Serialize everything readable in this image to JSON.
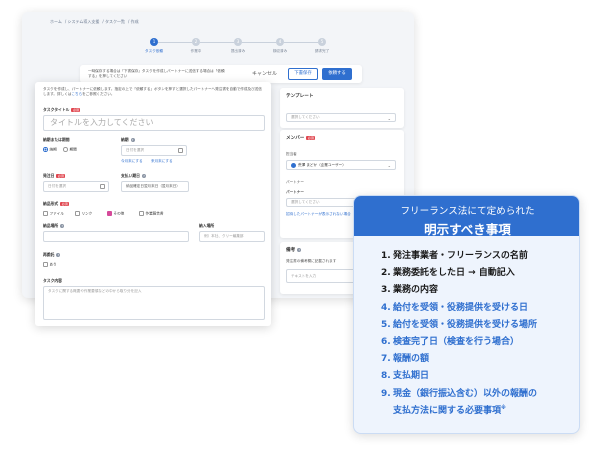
{
  "breadcrumb": [
    "ホーム",
    "システム導入支援",
    "タスク一覧",
    "作成"
  ],
  "stepper": {
    "steps": [
      {
        "num": "1",
        "label": "タスク依頼"
      },
      {
        "num": "2",
        "label": "作業中"
      },
      {
        "num": "3",
        "label": "提出済み"
      },
      {
        "num": "4",
        "label": "検収済み"
      },
      {
        "num": "5",
        "label": "請求完了"
      }
    ]
  },
  "action_bar": {
    "note": "一時保存する場合は「下書保存」タスクを作成しパートナーに送信する場合は「依頼する」を押してください",
    "cancel_label": "キャンセル",
    "draft_label": "下書保存",
    "submit_label": "依頼する"
  },
  "form": {
    "intro_before": "タスクを作成し、パートナーに依頼します。指定の上で「依頼する」ボタンを押すと選択したパートナーへ発注書を自動で作成及び送信します。詳しくは",
    "intro_link": "こちら",
    "intro_after": "をご参照ください。",
    "title_label": "タスクタイトル",
    "required_badge": "必須",
    "title_placeholder": "タイトルを入力してください",
    "period_label": "納期または期間",
    "period_opt1": "納期",
    "period_opt2": "期間",
    "deadline_label": "納期",
    "deadline_placeholder": "日付を選択",
    "month_end": "今月末にする",
    "next_month_end": "来月末にする",
    "order_date_label": "発注日",
    "order_date_placeholder": "日付を選択",
    "pay_due_label": "支払い期日",
    "pay_due_value": "納品確定日翌月末日（翌月末日）",
    "format_label": "納品形式",
    "format_opts": [
      "ファイル",
      "リンク",
      "その他",
      "作業報告書"
    ],
    "place_label": "納品場所",
    "work_place_label": "納入場所",
    "work_place_placeholder": "例）本社、クリー編集部",
    "recur_label": "再委託",
    "recur_opt": "あり",
    "content_label": "タスク内容",
    "content_placeholder": "タスクに関する概要や作業要領などの中から取り分を記入"
  },
  "template": {
    "title": "テンプレート",
    "select_placeholder": "選択してください"
  },
  "member": {
    "title": "メンバー",
    "person_label": "担当者",
    "person_value": "荒澤 まどか（企業ユーザー）",
    "partner_label": "パートナー",
    "partner_sub": "パートナー",
    "partner_placeholder": "選択してください",
    "partner_link": "招待したパートナーが表示されない場合"
  },
  "memo": {
    "title": "備考",
    "sub": "発注書の備考欄に記載されます",
    "placeholder": "テキストを入力"
  },
  "info_panel": {
    "heading1": "フリーランス法にて定められた",
    "heading2": "明示すべき事項",
    "items": [
      {
        "num": "1.",
        "text": "発注事業者・フリーランスの名前",
        "blue": false
      },
      {
        "num": "2.",
        "text": "業務委託をした日 → 自動記入",
        "blue": false
      },
      {
        "num": "3.",
        "text": "業務の内容",
        "blue": false
      },
      {
        "num": "4.",
        "text": "給付を受領・役務提供を受ける日",
        "blue": true
      },
      {
        "num": "5.",
        "text": "給付を受領・役務提供を受ける場所",
        "blue": true
      },
      {
        "num": "6.",
        "text": "検査完了日（検査を行う場合）",
        "blue": true
      },
      {
        "num": "7.",
        "text": "報酬の額",
        "blue": true
      },
      {
        "num": "8.",
        "text": "支払期日",
        "blue": true
      },
      {
        "num": "9.",
        "text": "現金（銀行振込含む）以外の報酬の",
        "blue": true
      }
    ],
    "item9_line2": "支払方法に関する必要事項",
    "item9_mark": "※"
  },
  "colors": {
    "accent": "#2f6fcf",
    "required": "#e0464f",
    "panel_bg": "#eef4fd"
  }
}
